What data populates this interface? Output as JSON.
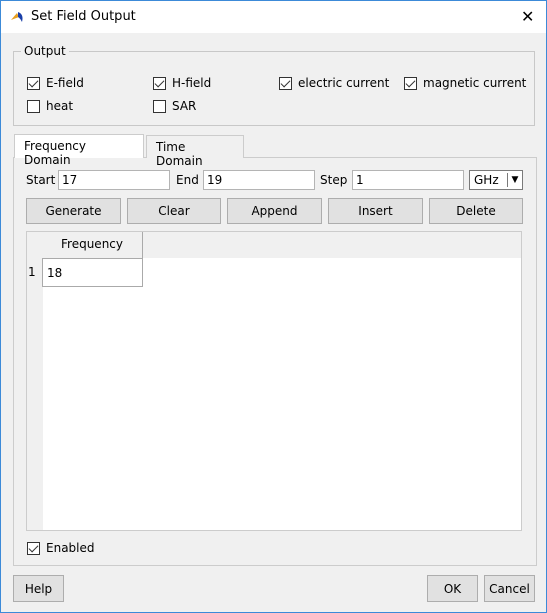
{
  "window": {
    "title": "Set Field Output",
    "close": "✕"
  },
  "output": {
    "legend": "Output",
    "checkboxes": [
      {
        "label": "E-field",
        "checked": true
      },
      {
        "label": "H-field",
        "checked": true
      },
      {
        "label": "electric current",
        "checked": true
      },
      {
        "label": "magnetic current",
        "checked": true
      },
      {
        "label": "heat",
        "checked": false
      },
      {
        "label": "SAR",
        "checked": false
      }
    ]
  },
  "tabs": [
    {
      "label": "Frequency Domain",
      "active": true
    },
    {
      "label": "Time Domain",
      "active": false
    }
  ],
  "range": {
    "start_label": "Start",
    "start": "17",
    "end_label": "End",
    "end": "19",
    "step_label": "Step",
    "step": "1",
    "unit": "GHz"
  },
  "buttons": {
    "generate": "Generate",
    "clear": "Clear",
    "append": "Append",
    "insert": "Insert",
    "delete": "Delete"
  },
  "table": {
    "header": "Frequency",
    "rows": [
      {
        "index": "1",
        "value": "18"
      }
    ]
  },
  "enabled": {
    "label": "Enabled",
    "checked": true
  },
  "footer": {
    "help": "Help",
    "ok": "OK",
    "cancel": "Cancel"
  }
}
